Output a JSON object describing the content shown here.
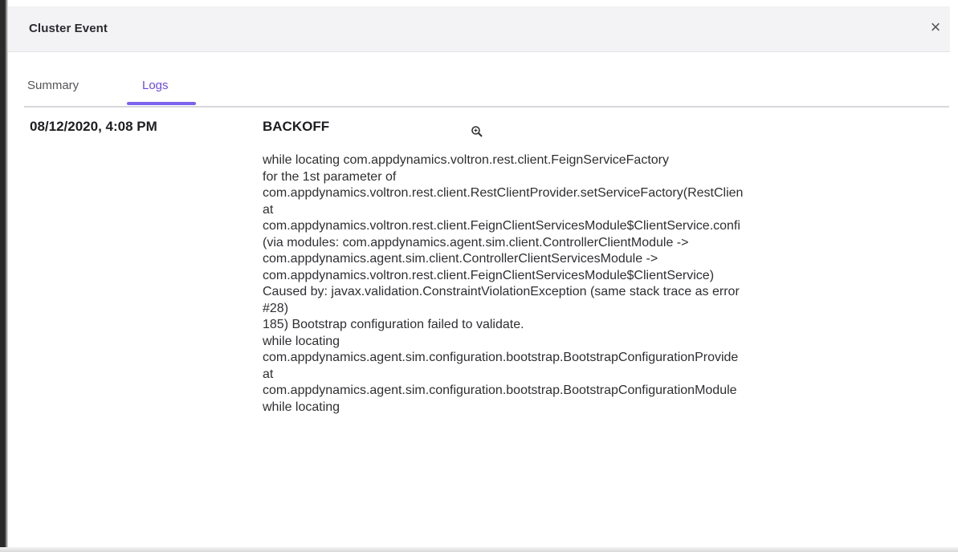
{
  "dialog": {
    "title": "Cluster Event",
    "close_label": "×"
  },
  "tabs": [
    {
      "label": "Summary",
      "active": false
    },
    {
      "label": "Logs",
      "active": true
    }
  ],
  "log_entry": {
    "timestamp": "08/12/2020, 4:08 PM",
    "event": "BACKOFF",
    "lines": [
      "while locating com.appdynamics.voltron.rest.client.FeignServiceFactory",
      "for the 1st parameter of",
      "com.appdynamics.voltron.rest.client.RestClientProvider.setServiceFactory(RestClien",
      "at",
      "com.appdynamics.voltron.rest.client.FeignClientServicesModule$ClientService.confi",
      "(via modules: com.appdynamics.agent.sim.client.ControllerClientModule ->",
      "com.appdynamics.agent.sim.client.ControllerClientServicesModule ->",
      "com.appdynamics.voltron.rest.client.FeignClientServicesModule$ClientService)",
      "Caused by: javax.validation.ConstraintViolationException (same stack trace as error",
      "#28)",
      "185) Bootstrap configuration failed to validate.",
      "while locating",
      "com.appdynamics.agent.sim.configuration.bootstrap.BootstrapConfigurationProvide",
      "at",
      "com.appdynamics.agent.sim.configuration.bootstrap.BootstrapConfigurationModule",
      "while locating"
    ]
  },
  "colors": {
    "accent": "#7c62ee",
    "active_tab_text": "#6a49e8",
    "header_bg": "#f3f3f5"
  },
  "icons": {
    "close": "close-icon",
    "cursor": "zoom-in-icon"
  }
}
